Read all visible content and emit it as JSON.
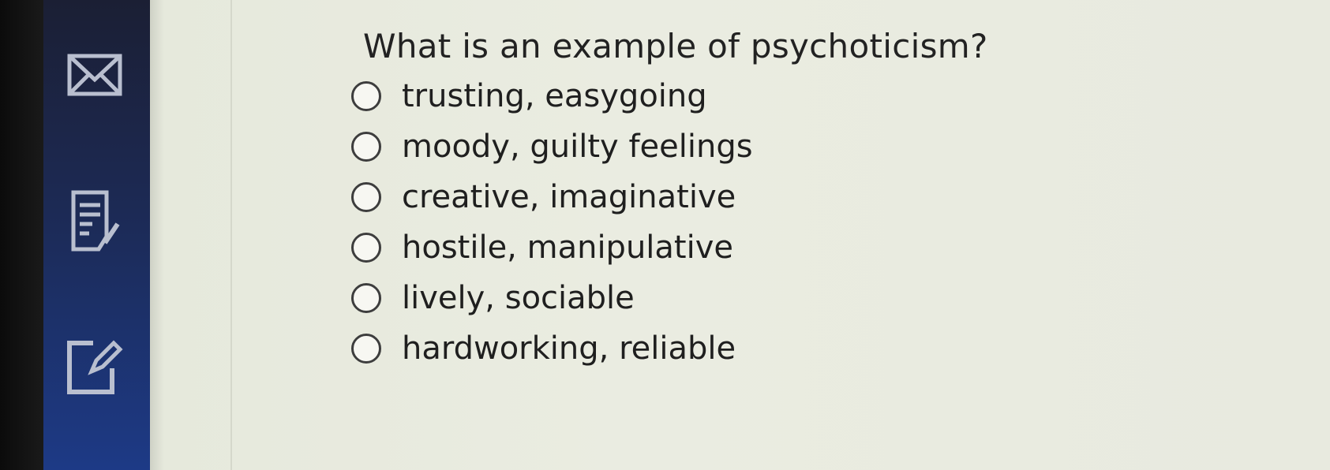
{
  "sidebar": {
    "icons": [
      "mail-icon",
      "notes-icon",
      "edit-icon"
    ],
    "rail_color": "#1d3a86"
  },
  "question": {
    "text": "What is an example of psychoticism?",
    "options": [
      {
        "label": "trusting, easygoing"
      },
      {
        "label": "moody, guilty feelings"
      },
      {
        "label": "creative, imaginative"
      },
      {
        "label": "hostile, manipulative"
      },
      {
        "label": "lively, sociable"
      },
      {
        "label": "hardworking, reliable"
      }
    ]
  }
}
